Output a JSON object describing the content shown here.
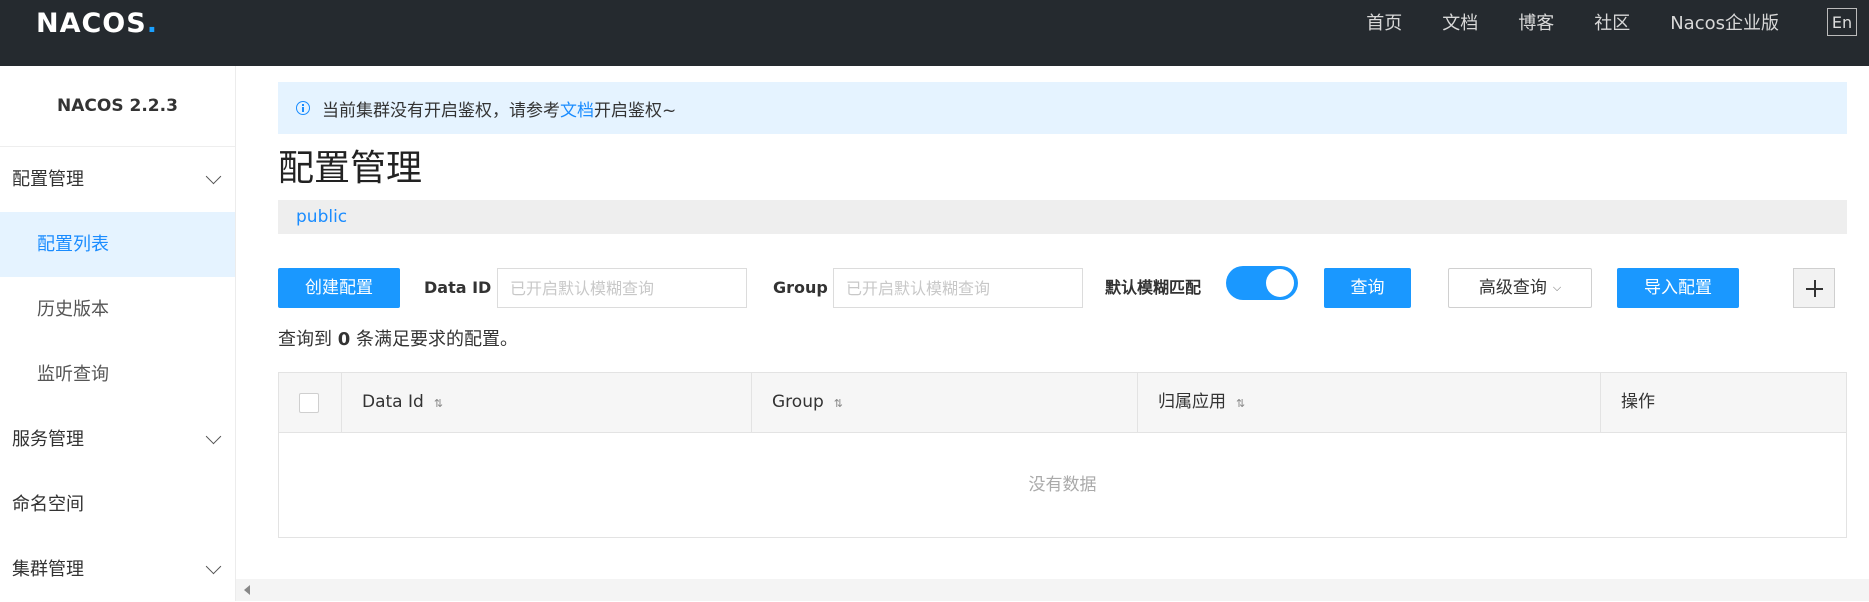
{
  "header": {
    "logo_text": "NACOS",
    "logo_dot": ".",
    "nav": [
      "首页",
      "文档",
      "博客",
      "社区",
      "Nacos企业版"
    ],
    "lang": "En"
  },
  "sidebar": {
    "version": "NACOS 2.2.3",
    "items": [
      {
        "label": "配置管理",
        "level": "top",
        "expandable": true
      },
      {
        "label": "配置列表",
        "level": "sub",
        "active": true
      },
      {
        "label": "历史版本",
        "level": "sub"
      },
      {
        "label": "监听查询",
        "level": "sub"
      },
      {
        "label": "服务管理",
        "level": "top",
        "expandable": true
      },
      {
        "label": "命名空间",
        "level": "top"
      },
      {
        "label": "集群管理",
        "level": "top",
        "expandable": true
      }
    ]
  },
  "notice": {
    "text_before": "当前集群没有开启鉴权，请参考",
    "link": "文档",
    "text_after": "开启鉴权~"
  },
  "page_title": "配置管理",
  "namespace": {
    "active": "public"
  },
  "toolbar": {
    "create_label": "创建配置",
    "dataid_label": "Data ID",
    "dataid_placeholder": "已开启默认模糊查询",
    "group_label": "Group",
    "group_placeholder": "已开启默认模糊查询",
    "fuzzy_label": "默认模糊匹配",
    "fuzzy_on": true,
    "query_label": "查询",
    "advanced_label": "高级查询",
    "import_label": "导入配置"
  },
  "result": {
    "prefix": "查询到 ",
    "count": "0",
    "suffix": " 条满足要求的配置。"
  },
  "table": {
    "columns": [
      "Data Id",
      "Group",
      "归属应用",
      "操作"
    ],
    "empty_text": "没有数据"
  },
  "colors": {
    "accent": "#1a98ff",
    "topbar": "#252a2f",
    "notice_bg": "#e5f3ff"
  }
}
